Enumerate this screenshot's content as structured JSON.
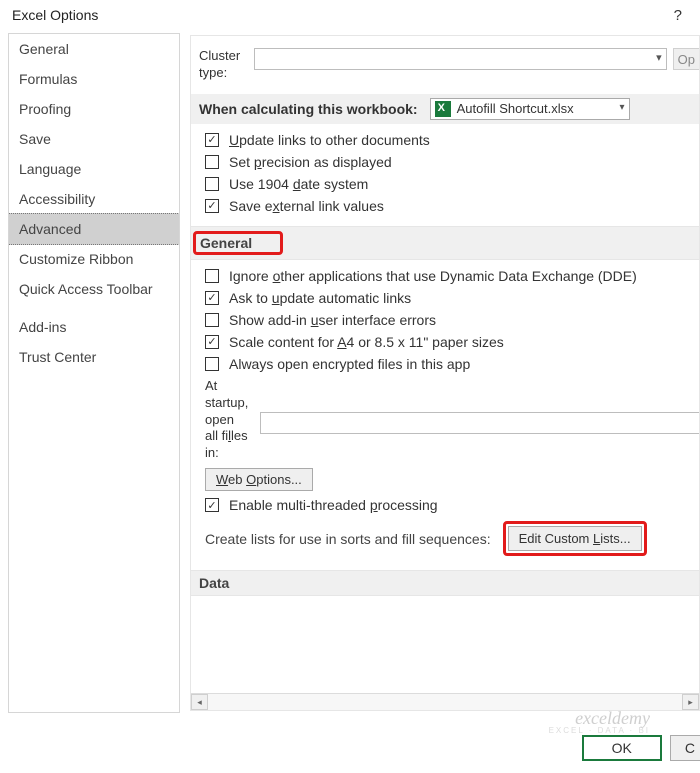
{
  "window": {
    "title": "Excel Options"
  },
  "sidebar": {
    "items": [
      {
        "label": "General"
      },
      {
        "label": "Formulas"
      },
      {
        "label": "Proofing"
      },
      {
        "label": "Save"
      },
      {
        "label": "Language"
      },
      {
        "label": "Accessibility"
      },
      {
        "label": "Advanced"
      },
      {
        "label": "Customize Ribbon"
      },
      {
        "label": "Quick Access Toolbar"
      },
      {
        "label": "Add-ins"
      },
      {
        "label": "Trust Center"
      }
    ],
    "active_index": 6
  },
  "cluster": {
    "label_line1": "Cluster",
    "label_line2": "type:",
    "options_btn": "Op"
  },
  "workbook_section": {
    "label": "When calculating this workbook:",
    "selected": "Autofill Shortcut.xlsx",
    "checks": [
      {
        "checked": true,
        "pre": "",
        "u": "U",
        "post": "pdate links to other documents"
      },
      {
        "checked": false,
        "pre": "Set ",
        "u": "p",
        "post": "recision as displayed"
      },
      {
        "checked": false,
        "pre": "Use 1904 ",
        "u": "d",
        "post": "ate system"
      },
      {
        "checked": true,
        "pre": "Save e",
        "u": "x",
        "post": "ternal link values"
      }
    ]
  },
  "general_section": {
    "title": "General",
    "checks": [
      {
        "checked": false,
        "pre": "Ignore ",
        "u": "o",
        "post": "ther applications that use Dynamic Data Exchange (DDE)"
      },
      {
        "checked": true,
        "pre": "Ask to ",
        "u": "u",
        "post": "pdate automatic links"
      },
      {
        "checked": false,
        "pre": "Show add-in ",
        "u": "u",
        "post": "ser interface errors"
      },
      {
        "checked": true,
        "pre": "Scale content for ",
        "u": "A",
        "post": "4 or 8.5 x 11\" paper sizes"
      },
      {
        "checked": false,
        "pre": "Always open encrypted files in this app",
        "u": "",
        "post": ""
      }
    ],
    "startup_label": "At startup, open all files in:",
    "startup_label_lines": [
      "At",
      "startup,",
      "open",
      "all fi",
      "les",
      "in:"
    ],
    "startup_label_u": "l",
    "web_options_btn": "Web Options...",
    "enable_mt": {
      "checked": true,
      "pre": "Enable multi-threaded ",
      "u": "p",
      "post": "rocessing"
    },
    "create_lists_text": "Create lists for use in sorts and fill sequences:",
    "edit_custom_btn": "Edit Custom Lists..."
  },
  "data_section": {
    "title": "Data"
  },
  "footer": {
    "ok": "OK",
    "cancel": "C"
  },
  "watermark": {
    "brand": "exceldemy",
    "tag": "EXCEL · DATA · BI"
  }
}
